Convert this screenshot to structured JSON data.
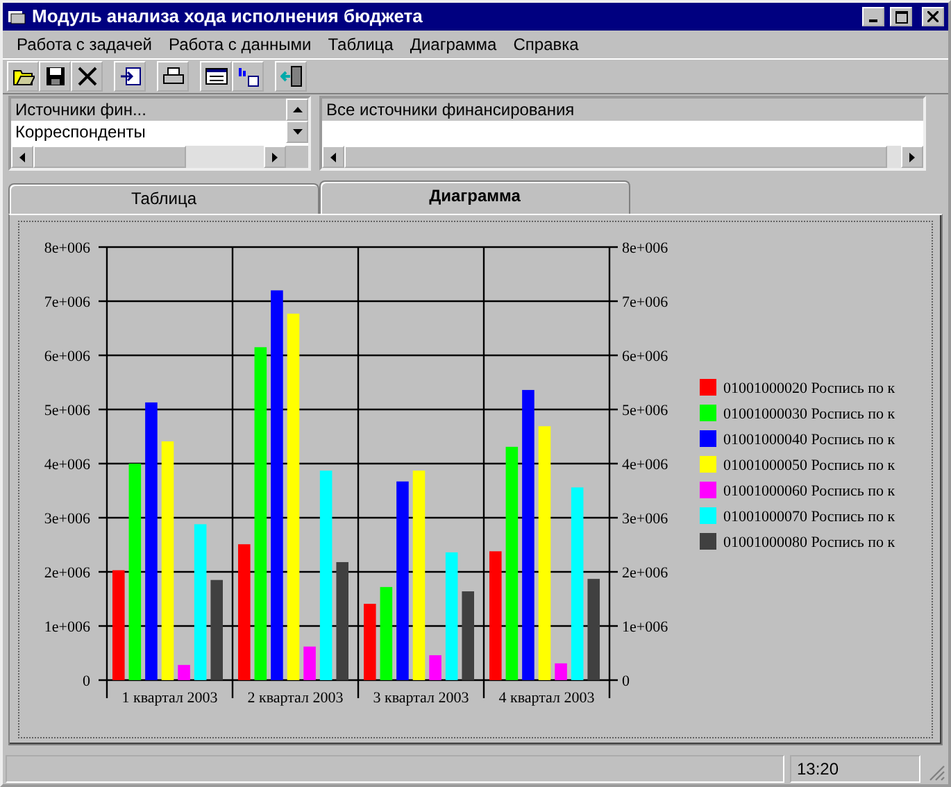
{
  "window": {
    "title": "Модуль анализа хода исполнения бюджета"
  },
  "menu": [
    "Работа с задачей",
    "Работа с данными",
    "Таблица",
    "Диаграмма",
    "Справка"
  ],
  "left_list": {
    "items": [
      {
        "label": "Источники фин...",
        "selected": true
      },
      {
        "label": "Корреспонденты",
        "selected": false
      }
    ]
  },
  "right_list": {
    "items": [
      {
        "label": "Все источники финансирования",
        "selected": true
      }
    ]
  },
  "tabs": [
    {
      "label": "Таблица",
      "selected": false
    },
    {
      "label": "Диаграмма",
      "selected": true
    }
  ],
  "chart_data": {
    "type": "bar",
    "categories": [
      "1 квартал 2003",
      "2 квартал 2003",
      "3 квартал 2003",
      "4 квартал 2003"
    ],
    "ylim": [
      0,
      8000000
    ],
    "grid": true,
    "legend": true,
    "yticks": [
      {
        "value": 0,
        "label": "0"
      },
      {
        "value": 1000000,
        "label": "1e+006"
      },
      {
        "value": 2000000,
        "label": "2e+006"
      },
      {
        "value": 3000000,
        "label": "3e+006"
      },
      {
        "value": 4000000,
        "label": "4e+006"
      },
      {
        "value": 5000000,
        "label": "5e+006"
      },
      {
        "value": 6000000,
        "label": "6e+006"
      },
      {
        "value": 7000000,
        "label": "7e+006"
      },
      {
        "value": 8000000,
        "label": "8e+006"
      }
    ],
    "series": [
      {
        "name": "01001000020 Роспись по к",
        "color": "#ff0000",
        "values": [
          2030000,
          2510000,
          1410000,
          2380000
        ]
      },
      {
        "name": "01001000030 Роспись по к",
        "color": "#00ff00",
        "values": [
          4000000,
          6150000,
          1720000,
          4310000
        ]
      },
      {
        "name": "01001000040 Роспись по к",
        "color": "#0000ff",
        "values": [
          5130000,
          7200000,
          3670000,
          5360000
        ]
      },
      {
        "name": "01001000050 Роспись по к",
        "color": "#ffff00",
        "values": [
          4410000,
          6770000,
          3870000,
          4690000
        ]
      },
      {
        "name": "01001000060 Роспись по к",
        "color": "#ff00ff",
        "values": [
          280000,
          620000,
          460000,
          310000
        ]
      },
      {
        "name": "01001000070 Роспись по к",
        "color": "#00ffff",
        "values": [
          2880000,
          3870000,
          2360000,
          3560000
        ]
      },
      {
        "name": "01001000080 Роспись по к",
        "color": "#404040",
        "values": [
          1850000,
          2180000,
          1640000,
          1870000
        ]
      }
    ]
  },
  "status_bar": {
    "time": "13:20"
  }
}
